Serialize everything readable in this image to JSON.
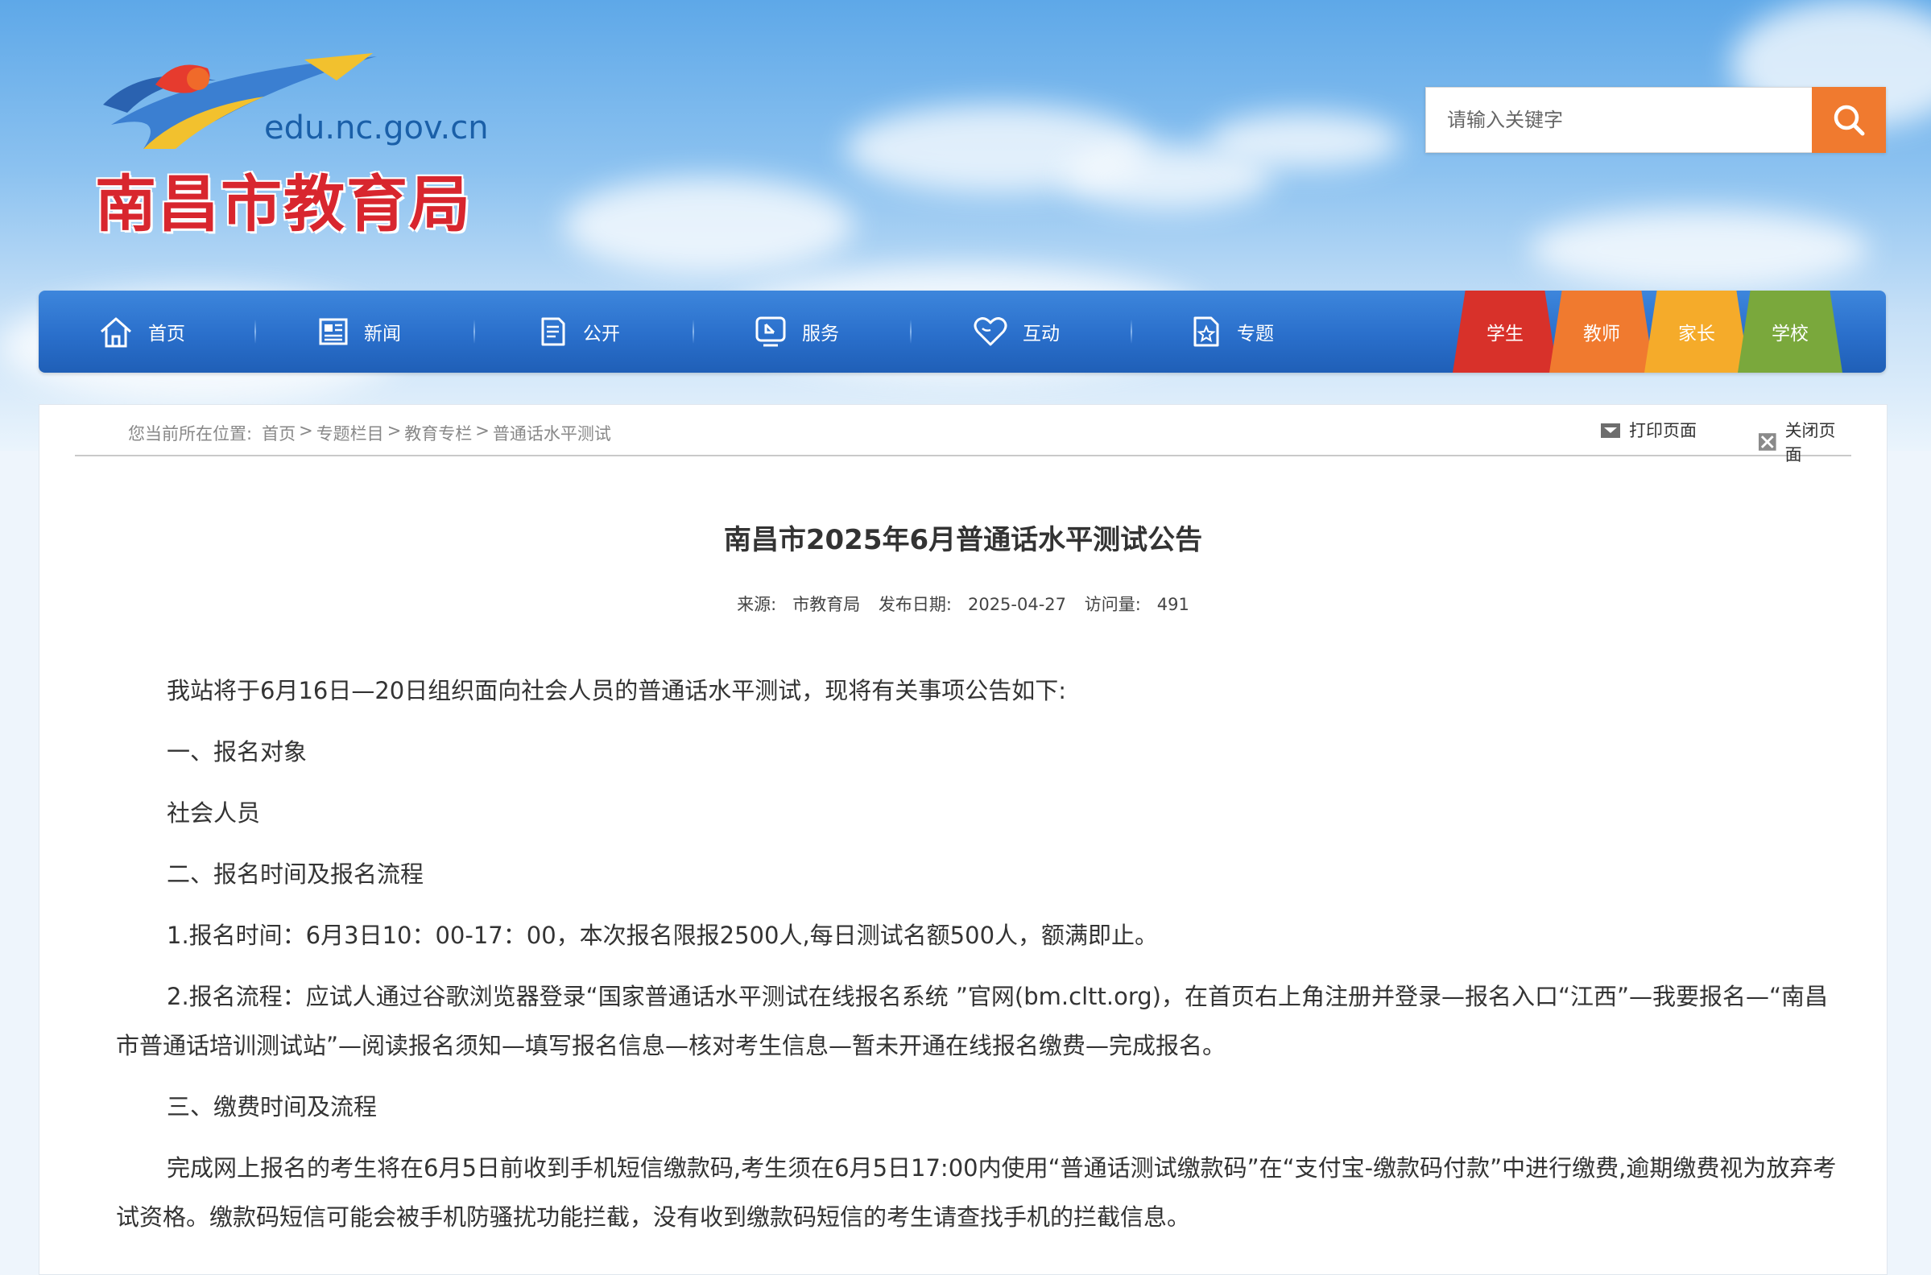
{
  "header": {
    "logo_domain": "edu.nc.gov.cn",
    "logo_title": "南昌市教育局",
    "search_placeholder": "请输入关键字"
  },
  "nav": {
    "items": [
      {
        "label": "首页",
        "icon": "home-icon"
      },
      {
        "label": "新闻",
        "icon": "newspaper-icon"
      },
      {
        "label": "公开",
        "icon": "document-icon"
      },
      {
        "label": "服务",
        "icon": "service-icon"
      },
      {
        "label": "互动",
        "icon": "heart-icon"
      },
      {
        "label": "专题",
        "icon": "star-doc-icon"
      }
    ],
    "tags": [
      {
        "label": "学生",
        "color": "#d8312a"
      },
      {
        "label": "教师",
        "color": "#f07a2f"
      },
      {
        "label": "家长",
        "color": "#f5ab2a"
      },
      {
        "label": "学校",
        "color": "#7aa83c"
      }
    ]
  },
  "breadcrumb": {
    "prefix": "您当前所在位置:",
    "items": [
      "首页",
      "专题栏目",
      "教育专栏",
      "普通话水平测试"
    ],
    "separator": ">"
  },
  "tools": {
    "print": "打印页面",
    "close": "关闭页面"
  },
  "article": {
    "title": "南昌市2025年6月普通话水平测试公告",
    "source_label": "来源:",
    "source": "市教育局",
    "date_label": "发布日期:",
    "date": "2025-04-27",
    "views_label": "访问量:",
    "views": "491",
    "paragraphs": [
      "我站将于6月16日—20日组织面向社会人员的普通话水平测试，现将有关事项公告如下:",
      "一、报名对象",
      "社会人员",
      "二、报名时间及报名流程",
      "1.报名时间：6月3日10：00-17：00，本次报名限报2500人,每日测试名额500人，额满即止。",
      "2.报名流程：应试人通过谷歌浏览器登录“国家普通话水平测试在线报名系统 ”官网(bm.cltt.org)，在首页右上角注册并登录—报名入口“江西”—我要报名—“南昌市普通话培训测试站”—阅读报名须知—填写报名信息—核对考生信息—暂未开通在线报名缴费—完成报名。",
      "三、缴费时间及流程",
      "完成网上报名的考生将在6月5日前收到手机短信缴款码,考生须在6月5日17:00内使用“普通话测试缴款码”在“支付宝-缴款码付款”中进行缴费,逾期缴费视为放弃考试资格。缴款码短信可能会被手机防骚扰功能拦截，没有收到缴款码短信的考生请查找手机的拦截信息。"
    ]
  }
}
